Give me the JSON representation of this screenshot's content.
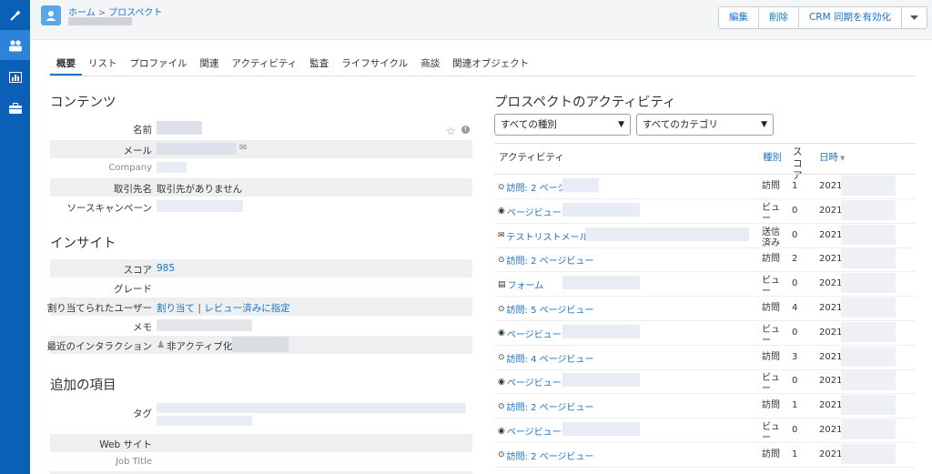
{
  "nav": {
    "icons": [
      "magic-wand-icon",
      "people-icon",
      "report-chart-icon",
      "briefcase-icon"
    ]
  },
  "header": {
    "breadcrumb_home": "ホーム",
    "breadcrumb_sep": ">",
    "breadcrumb_current": "プロスペクト",
    "buttons": {
      "edit": "編集",
      "delete": "削除",
      "crm_sync": "CRM 同期を有効化",
      "more_icon": "chevron-down-icon"
    }
  },
  "tabs": [
    "概要",
    "リスト",
    "プロファイル",
    "関連",
    "アクティビティ",
    "監査",
    "ライフサイクル",
    "商談",
    "関連オブジェクト"
  ],
  "contents": {
    "title": "コンテンツ",
    "fields": {
      "name_label": "名前",
      "email_label": "メール",
      "company_label": "Company",
      "account_label": "取引先名",
      "account_value": "取引先がありません",
      "source_campaign_label": "ソースキャンペーン"
    }
  },
  "insights": {
    "title": "インサイト",
    "score_label": "スコア",
    "score_value": "985",
    "grade_label": "グレード",
    "assigned_user_label": "割り当てられたユーザー",
    "assign_link": "割り当て",
    "assign_sep": "|",
    "review_link": "レビュー済みに指定",
    "memo_label": "メモ",
    "last_interaction_label": "最近のインタラクション",
    "last_interaction_value": "非アクティブ化日:"
  },
  "additional": {
    "title": "追加の項目",
    "tag_label": "タグ",
    "website_label": "Web サイト",
    "job_title_label": "Job Title"
  },
  "activities": {
    "title": "プロスペクトのアクティビティ",
    "filter_type": "すべての種別",
    "filter_category": "すべてのカテゴリ",
    "col_activity": "アクティビティ",
    "col_type": "種別",
    "col_score": "スコア",
    "col_date": "日時",
    "rows": [
      {
        "icon": "clock-icon",
        "glyph": "⊙",
        "label": "訪問: 2 ページビュー",
        "type": "訪問",
        "score": "1",
        "year": "2021"
      },
      {
        "icon": "eye-icon",
        "glyph": "◉",
        "label": "ページビュー",
        "type": "ビュー",
        "score": "0",
        "year": "2021"
      },
      {
        "icon": "email-icon",
        "glyph": "✉",
        "label": "テストリストメール",
        "type": "送信済み",
        "score": "0",
        "year": "2021"
      },
      {
        "icon": "clock-icon",
        "glyph": "⊙",
        "label": "訪問: 2 ページビュー",
        "type": "訪問",
        "score": "2",
        "year": "2021"
      },
      {
        "icon": "form-icon",
        "glyph": "▤",
        "label": "フォーム",
        "type": "ビュー",
        "score": "0",
        "year": "2021"
      },
      {
        "icon": "clock-icon",
        "glyph": "⊙",
        "label": "訪問: 5 ページビュー",
        "type": "訪問",
        "score": "4",
        "year": "2021"
      },
      {
        "icon": "eye-icon",
        "glyph": "◉",
        "label": "ページビュー",
        "type": "ビュー",
        "score": "0",
        "year": "2021"
      },
      {
        "icon": "clock-icon",
        "glyph": "⊙",
        "label": "訪問: 4 ページビュー",
        "type": "訪問",
        "score": "3",
        "year": "2021"
      },
      {
        "icon": "eye-icon",
        "glyph": "◉",
        "label": "ページビュー",
        "type": "ビュー",
        "score": "0",
        "year": "2021"
      },
      {
        "icon": "clock-icon",
        "glyph": "⊙",
        "label": "訪問: 2 ページビュー",
        "type": "訪問",
        "score": "1",
        "year": "2021"
      },
      {
        "icon": "eye-icon",
        "glyph": "◉",
        "label": "ページビュー",
        "type": "ビュー",
        "score": "0",
        "year": "2021"
      },
      {
        "icon": "clock-icon",
        "glyph": "⊙",
        "label": "訪問: 2 ページビュー",
        "type": "訪問",
        "score": "1",
        "year": "2021"
      }
    ]
  },
  "colors": {
    "nav_bg": "#0c5fb6",
    "link": "#1a73c7",
    "shade_row": "#eeeff1"
  }
}
